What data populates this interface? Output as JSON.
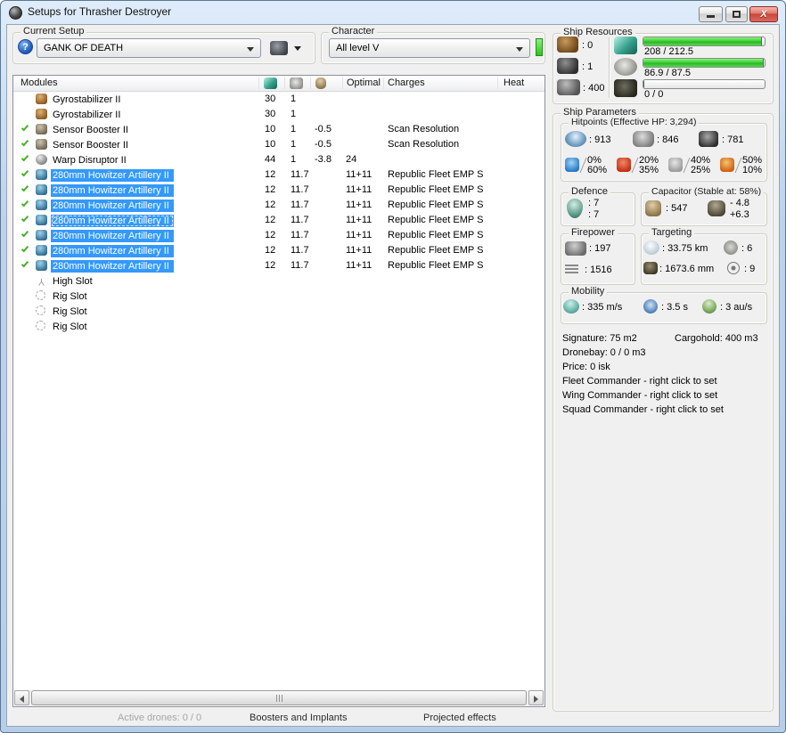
{
  "window": {
    "title": "Setups for Thrasher Destroyer"
  },
  "toolbar": {
    "current_setup_label": "Current Setup",
    "current_setup_value": "GANK OF DEATH",
    "character_label": "Character",
    "character_value": "All level V",
    "help_glyph": "?"
  },
  "modules_table": {
    "headers": {
      "modules": "Modules",
      "optimal": "Optimal",
      "charges": "Charges",
      "heat": "Heat"
    },
    "header_icons": [
      "cpu-icon",
      "powergrid-icon",
      "capacitor-icon"
    ],
    "rows": [
      {
        "check": false,
        "icon": "gyrostabilizer",
        "name": "Gyrostabilizer II",
        "cpu": "30",
        "pg": "1",
        "cap": "",
        "optimal": "",
        "charges": "",
        "selected": false,
        "focused": false
      },
      {
        "check": false,
        "icon": "gyrostabilizer",
        "name": "Gyrostabilizer II",
        "cpu": "30",
        "pg": "1",
        "cap": "",
        "optimal": "",
        "charges": "",
        "selected": false,
        "focused": false
      },
      {
        "check": true,
        "icon": "sensor-booster",
        "name": "Sensor Booster II",
        "cpu": "10",
        "pg": "1",
        "cap": "-0.5",
        "optimal": "",
        "charges": "Scan Resolution",
        "selected": false,
        "focused": false
      },
      {
        "check": true,
        "icon": "sensor-booster",
        "name": "Sensor Booster II",
        "cpu": "10",
        "pg": "1",
        "cap": "-0.5",
        "optimal": "",
        "charges": "Scan Resolution",
        "selected": false,
        "focused": false
      },
      {
        "check": true,
        "icon": "warp-disruptor",
        "name": "Warp Disruptor II",
        "cpu": "44",
        "pg": "1",
        "cap": "-3.8",
        "optimal": "24",
        "charges": "",
        "selected": false,
        "focused": false
      },
      {
        "check": true,
        "icon": "artillery",
        "name": "280mm Howitzer Artillery II",
        "cpu": "12",
        "pg": "11.7",
        "cap": "",
        "optimal": "11+11",
        "charges": "Republic Fleet EMP S",
        "selected": true,
        "focused": false
      },
      {
        "check": true,
        "icon": "artillery",
        "name": "280mm Howitzer Artillery II",
        "cpu": "12",
        "pg": "11.7",
        "cap": "",
        "optimal": "11+11",
        "charges": "Republic Fleet EMP S",
        "selected": true,
        "focused": false
      },
      {
        "check": true,
        "icon": "artillery",
        "name": "280mm Howitzer Artillery II",
        "cpu": "12",
        "pg": "11.7",
        "cap": "",
        "optimal": "11+11",
        "charges": "Republic Fleet EMP S",
        "selected": true,
        "focused": false
      },
      {
        "check": true,
        "icon": "artillery",
        "name": "280mm Howitzer Artillery II",
        "cpu": "12",
        "pg": "11.7",
        "cap": "",
        "optimal": "11+11",
        "charges": "Republic Fleet EMP S",
        "selected": true,
        "focused": true
      },
      {
        "check": true,
        "icon": "artillery",
        "name": "280mm Howitzer Artillery II",
        "cpu": "12",
        "pg": "11.7",
        "cap": "",
        "optimal": "11+11",
        "charges": "Republic Fleet EMP S",
        "selected": true,
        "focused": false
      },
      {
        "check": true,
        "icon": "artillery",
        "name": "280mm Howitzer Artillery II",
        "cpu": "12",
        "pg": "11.7",
        "cap": "",
        "optimal": "11+11",
        "charges": "Republic Fleet EMP S",
        "selected": true,
        "focused": false
      },
      {
        "check": true,
        "icon": "artillery",
        "name": "280mm Howitzer Artillery II",
        "cpu": "12",
        "pg": "11.7",
        "cap": "",
        "optimal": "11+11",
        "charges": "Republic Fleet EMP S",
        "selected": true,
        "focused": false
      },
      {
        "check": false,
        "icon": "high-slot",
        "name": "High Slot",
        "cpu": "",
        "pg": "",
        "cap": "",
        "optimal": "",
        "charges": "",
        "selected": false,
        "focused": false
      },
      {
        "check": false,
        "icon": "rig-slot",
        "name": "Rig Slot",
        "cpu": "",
        "pg": "",
        "cap": "",
        "optimal": "",
        "charges": "",
        "selected": false,
        "focused": false
      },
      {
        "check": false,
        "icon": "rig-slot",
        "name": "Rig Slot",
        "cpu": "",
        "pg": "",
        "cap": "",
        "optimal": "",
        "charges": "",
        "selected": false,
        "focused": false
      },
      {
        "check": false,
        "icon": "rig-slot",
        "name": "Rig Slot",
        "cpu": "",
        "pg": "",
        "cap": "",
        "optimal": "",
        "charges": "",
        "selected": false,
        "focused": false
      }
    ]
  },
  "ship_resources": {
    "label": "Ship Resources",
    "turrets": ": 0",
    "launchers": ": 1",
    "calibration": ": 400",
    "cpu": {
      "text": "208 / 212.5",
      "pct": 97.9
    },
    "powergrid": {
      "text": "86.9 / 87.5",
      "pct": 99.3
    },
    "drones": {
      "text": "0 / 0",
      "pct": 0
    }
  },
  "ship_parameters": {
    "label": "Ship Parameters",
    "hitpoints": {
      "label": "Hitpoints (Effective HP: 3,294)",
      "shield": ": 913",
      "armor": ": 846",
      "hull": ": 781",
      "resists": [
        {
          "type": "em",
          "top": "0%",
          "bottom": "60%"
        },
        {
          "type": "thermal",
          "top": "20%",
          "bottom": "35%"
        },
        {
          "type": "kinetic",
          "top": "40%",
          "bottom": "25%"
        },
        {
          "type": "explosive",
          "top": "50%",
          "bottom": "10%"
        }
      ]
    },
    "defence": {
      "label": "Defence",
      "top": ": 7",
      "bottom": ": 7"
    },
    "capacitor": {
      "label": "Capacitor (Stable at: 58%)",
      "amount": ": 547",
      "peak": "- 4.8",
      "recharge": "+6.3"
    },
    "firepower": {
      "label": "Firepower",
      "volley": ": 197",
      "dps": ": 1516"
    },
    "targeting": {
      "label": "Targeting",
      "range": ": 33.75 km",
      "max_targets": ": 6",
      "scan_resolution": ": 1673.6 mm",
      "sensor_strength": ": 9"
    },
    "mobility": {
      "label": "Mobility",
      "speed": ": 335 m/s",
      "align_time": ": 3.5 s",
      "warp_speed": ": 3 au/s"
    },
    "info": {
      "signature": "Signature: 75 m2",
      "cargohold": "Cargohold: 400 m3",
      "dronebay": "Dronebay: 0 / 0 m3",
      "price": "Price: 0 isk",
      "fleet": "Fleet Commander - right click to set",
      "wing": "Wing Commander - right click to set",
      "squad": "Squad Commander - right click to set"
    }
  },
  "bottom_panels": {
    "active_drones": "Active drones: 0 / 0",
    "boosters": "Boosters and Implants",
    "projected": "Projected effects"
  },
  "colors": {
    "selection": "#3399ff",
    "progress_green": "#3ed23a",
    "close_button": "#c8473a",
    "check_green": "#45b226",
    "character_indicator": "#2ec512"
  }
}
